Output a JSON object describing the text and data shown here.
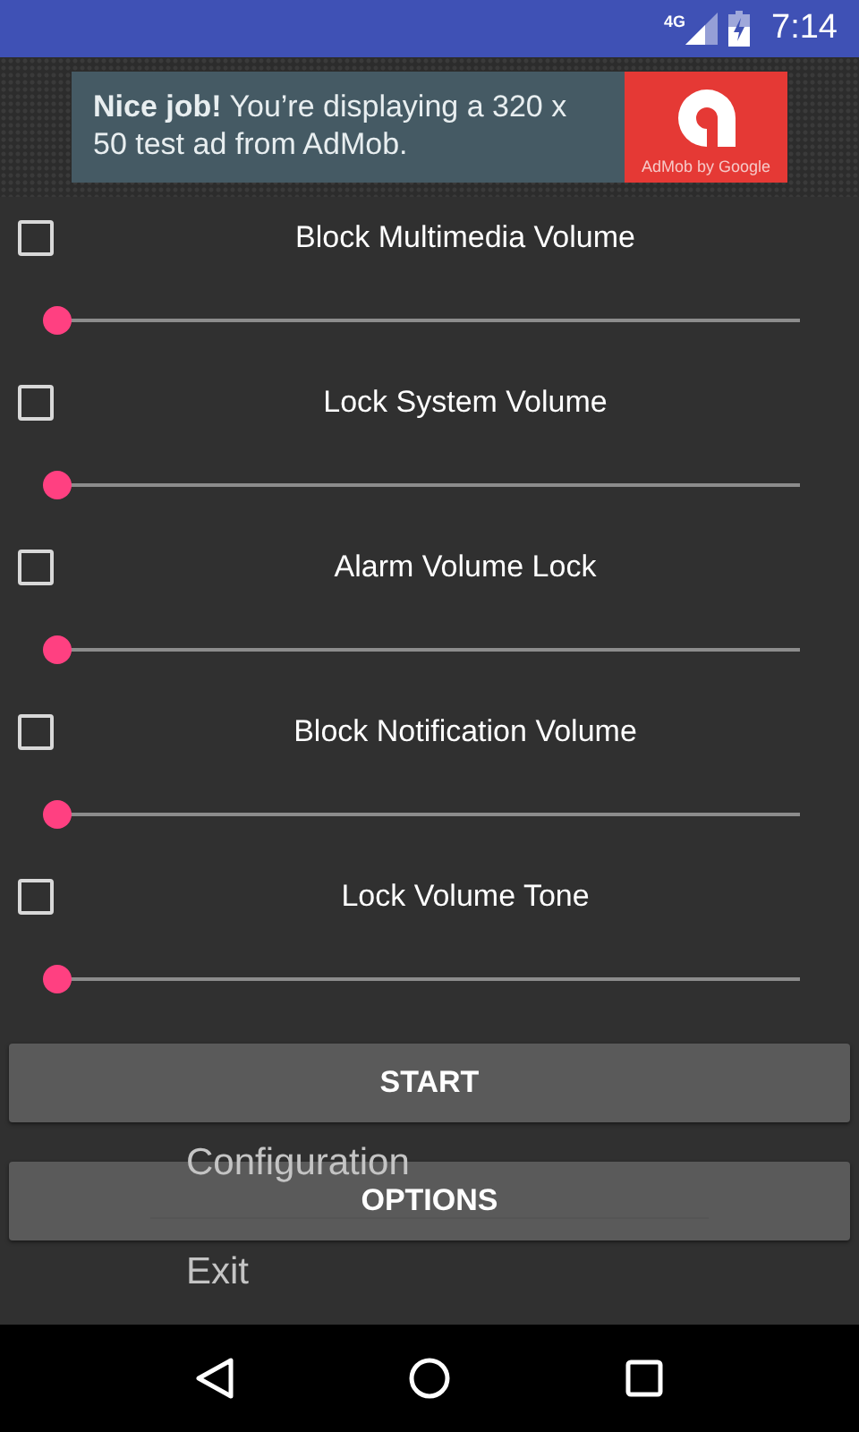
{
  "status_bar": {
    "network": "4G",
    "time": "7:14"
  },
  "ad": {
    "text": "**Nice job!** You’re displaying a 320 x 50 test ad from AdMob.",
    "badge": "AdMob by Google"
  },
  "settings": [
    {
      "label": "Block Multimedia Volume",
      "checked": false,
      "level": 0
    },
    {
      "label": "Lock System Volume",
      "checked": false,
      "level": 0
    },
    {
      "label": "Alarm Volume Lock",
      "checked": false,
      "level": 0
    },
    {
      "label": "Block Notification Volume",
      "checked": false,
      "level": 0
    },
    {
      "label": "Lock Volume Tone",
      "checked": false,
      "level": 0
    }
  ],
  "buttons": [
    "START",
    "OPTIONS"
  ],
  "menu": {
    "items": [
      "Configuration",
      "Exit"
    ]
  }
}
